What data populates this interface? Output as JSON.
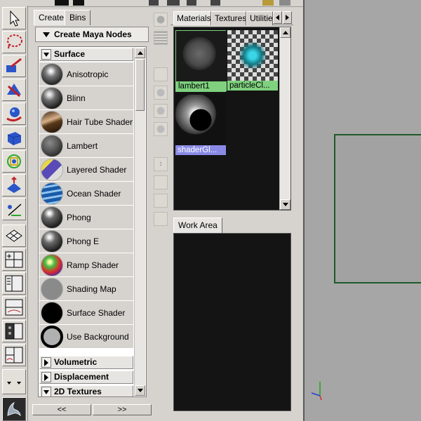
{
  "create_panel": {
    "tabs": [
      "Create",
      "Bins"
    ],
    "header": "Create Maya Nodes",
    "sections": {
      "surface": "Surface",
      "volumetric": "Volumetric",
      "displacement": "Displacement",
      "textures_2d": "2D Textures"
    },
    "surface_nodes": [
      {
        "label": "Anisotropic",
        "icon": "anisotropic-sphere-icon"
      },
      {
        "label": "Blinn",
        "icon": "blinn-sphere-icon"
      },
      {
        "label": "Hair Tube Shader",
        "icon": "hair-tube-icon"
      },
      {
        "label": "Lambert",
        "icon": "lambert-sphere-icon"
      },
      {
        "label": "Layered Shader",
        "icon": "layered-shader-icon"
      },
      {
        "label": "Ocean Shader",
        "icon": "ocean-shader-icon"
      },
      {
        "label": "Phong",
        "icon": "phong-sphere-icon"
      },
      {
        "label": "Phong E",
        "icon": "phong-e-sphere-icon"
      },
      {
        "label": "Ramp Shader",
        "icon": "ramp-shader-icon"
      },
      {
        "label": "Shading Map",
        "icon": "shading-map-icon"
      },
      {
        "label": "Surface Shader",
        "icon": "surface-shader-icon"
      },
      {
        "label": "Use Background",
        "icon": "use-background-icon"
      }
    ],
    "page_left": "<<",
    "page_right": ">>"
  },
  "hypershade": {
    "tabs": [
      "Materials",
      "Textures",
      "Utilitie"
    ],
    "materials": [
      {
        "label": "lambert1",
        "caption_color": "#7fd17f",
        "icon": "lambert-material-swatch"
      },
      {
        "label": "particleCl...",
        "caption_color": "#7fd17f",
        "icon": "particle-cloud-swatch"
      },
      {
        "label": "shaderGl...",
        "caption_color": "#8a8ae6",
        "icon": "shader-glow-swatch"
      }
    ],
    "work_area_tab": "Work Area"
  },
  "colors": {
    "panel_bg": "#d6d3ce",
    "swatch_area_bg": "#141414",
    "viewport_bg": "#a6a6a6",
    "plane_outline": "#1e5a2a"
  }
}
